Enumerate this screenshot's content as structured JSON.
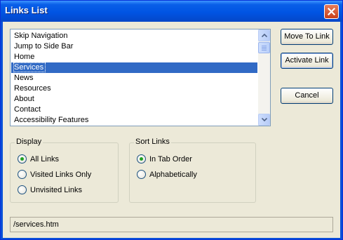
{
  "window": {
    "title": "Links List"
  },
  "links": {
    "items": [
      {
        "label": "Skip Navigation"
      },
      {
        "label": "Jump to Side Bar"
      },
      {
        "label": "Home"
      },
      {
        "label": "Services"
      },
      {
        "label": "News"
      },
      {
        "label": "Resources"
      },
      {
        "label": "About"
      },
      {
        "label": "Contact"
      },
      {
        "label": "Accessibility Features"
      }
    ],
    "selected": "Services"
  },
  "buttons": {
    "move_to_link": "Move To Link",
    "activate_link": "Activate Link",
    "cancel": "Cancel"
  },
  "display": {
    "label": "Display",
    "options": [
      {
        "label": "All Links",
        "checked": true
      },
      {
        "label": "Visited Links Only",
        "checked": false
      },
      {
        "label": "Unvisited Links",
        "checked": false
      }
    ]
  },
  "sort": {
    "label": "Sort Links",
    "options": [
      {
        "label": "In Tab Order",
        "checked": true
      },
      {
        "label": "Alphabetically",
        "checked": false
      }
    ]
  },
  "status": {
    "url": "/services.htm"
  },
  "colors": {
    "selection": "#316ac5",
    "titlebar": "#0054e3",
    "radio_dot": "#21a121"
  },
  "icons": {
    "close": "close-icon",
    "scroll_up": "scroll-up-icon",
    "scroll_down": "scroll-down-icon"
  }
}
